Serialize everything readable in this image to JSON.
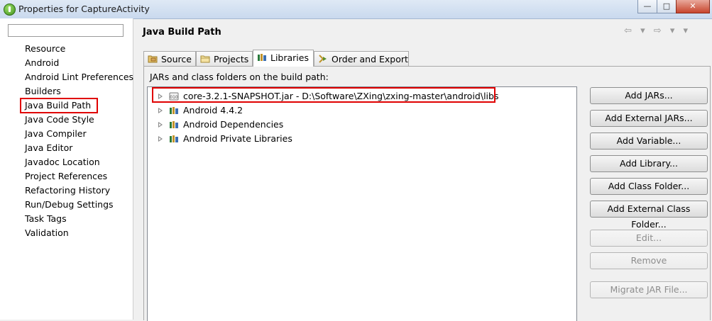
{
  "window": {
    "title": "Properties for CaptureActivity",
    "buttons": {
      "minimize": "—",
      "maximize": "□",
      "close": "✕"
    }
  },
  "sidebar": {
    "filter_value": "",
    "items": [
      {
        "label": "Resource",
        "expandable": true
      },
      {
        "label": "Android",
        "expandable": false
      },
      {
        "label": "Android Lint Preferences",
        "expandable": false
      },
      {
        "label": "Builders",
        "expandable": false
      },
      {
        "label": "Java Build Path",
        "expandable": false,
        "highlighted": true
      },
      {
        "label": "Java Code Style",
        "expandable": true
      },
      {
        "label": "Java Compiler",
        "expandable": true
      },
      {
        "label": "Java Editor",
        "expandable": true
      },
      {
        "label": "Javadoc Location",
        "expandable": false
      },
      {
        "label": "Project References",
        "expandable": false
      },
      {
        "label": "Refactoring History",
        "expandable": false
      },
      {
        "label": "Run/Debug Settings",
        "expandable": false
      },
      {
        "label": "Task Tags",
        "expandable": false
      },
      {
        "label": "Validation",
        "expandable": true
      }
    ]
  },
  "header": {
    "title": "Java Build Path",
    "nav_arrows": "⇦ ▾ ⇨ ▾ ▾"
  },
  "tabs": [
    {
      "label": "Source",
      "icon": "source-folder-icon",
      "active": false
    },
    {
      "label": "Projects",
      "icon": "projects-folder-icon",
      "active": false
    },
    {
      "label": "Libraries",
      "icon": "libraries-icon",
      "active": true
    },
    {
      "label": "Order and Export",
      "icon": "order-export-icon",
      "active": false
    }
  ],
  "libraries": {
    "label": "JARs and class folders on the build path:",
    "entries": [
      {
        "text": "core-3.2.1-SNAPSHOT.jar - D:\\Software\\ZXing\\zxing-master\\android\\libs",
        "icon": "jar-icon",
        "highlighted": true
      },
      {
        "text": "Android 4.4.2",
        "icon": "library-icon"
      },
      {
        "text": "Android Dependencies",
        "icon": "library-icon"
      },
      {
        "text": "Android Private Libraries",
        "icon": "library-icon"
      }
    ]
  },
  "buttons": {
    "add_jars": "Add JARs...",
    "add_external_jars": "Add External JARs...",
    "add_variable": "Add Variable...",
    "add_library": "Add Library...",
    "add_class_folder": "Add Class Folder...",
    "add_external_class_folder": "Add External Class Folder...",
    "edit": "Edit...",
    "remove": "Remove",
    "migrate_jar": "Migrate JAR File..."
  },
  "colors": {
    "highlight": "#e00000",
    "accent": "#3c7fb1"
  }
}
